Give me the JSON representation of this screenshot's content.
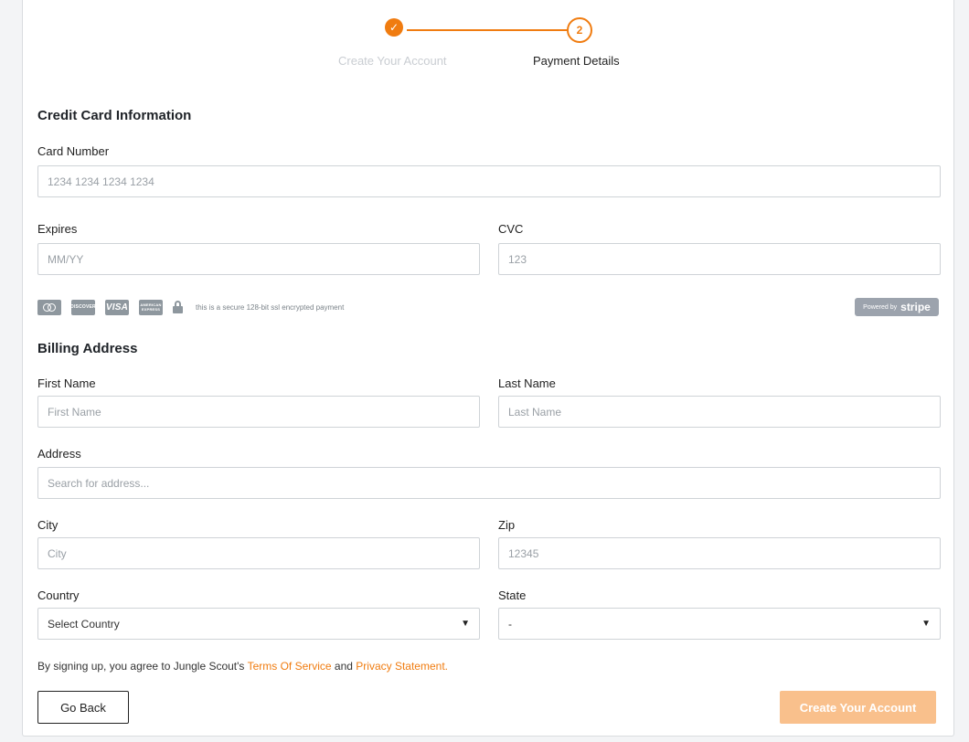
{
  "stepper": {
    "step1": {
      "label": "Create Your Account",
      "mark": "✓"
    },
    "step2": {
      "label": "Payment Details",
      "number": "2"
    }
  },
  "credit_card": {
    "title": "Credit Card Information",
    "card_number": {
      "label": "Card Number",
      "placeholder": "1234 1234 1234 1234"
    },
    "expires": {
      "label": "Expires",
      "placeholder": "MM/YY"
    },
    "cvc": {
      "label": "CVC",
      "placeholder": "123"
    },
    "icons": {
      "mastercard": "mastercard-icon",
      "discover": {
        "icon": "discover-icon",
        "text": "DISCOVER"
      },
      "visa": {
        "icon": "visa-icon",
        "text": "VISA"
      },
      "amex": {
        "icon": "amex-icon",
        "text": "AMERICAN EXPRESS"
      },
      "lock": "lock-icon"
    },
    "secure_text": "this is a secure 128-bit ssl encrypted payment",
    "stripe": {
      "prefix": "Powered by",
      "word": "stripe"
    }
  },
  "billing": {
    "title": "Billing Address",
    "first_name": {
      "label": "First Name",
      "placeholder": "First Name"
    },
    "last_name": {
      "label": "Last Name",
      "placeholder": "Last Name"
    },
    "address": {
      "label": "Address",
      "placeholder": "Search for address..."
    },
    "city": {
      "label": "City",
      "placeholder": "City"
    },
    "zip": {
      "label": "Zip",
      "placeholder": "12345"
    },
    "country": {
      "label": "Country",
      "selected": "Select Country"
    },
    "state": {
      "label": "State",
      "selected": "-"
    }
  },
  "terms": {
    "prefix": "By signing up, you agree to Jungle Scout's ",
    "tos": "Terms Of Service",
    "and": " and ",
    "privacy": "Privacy Statement."
  },
  "buttons": {
    "back": "Go Back",
    "create": "Create Your Account"
  },
  "colors": {
    "accent": "#f07c10",
    "create_button_disabled": "#f9c08c",
    "icon_gray": "#8e979e"
  }
}
